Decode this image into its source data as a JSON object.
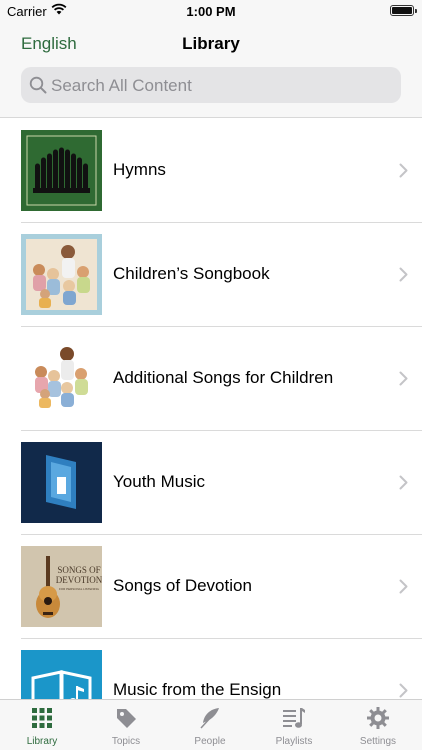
{
  "status_bar": {
    "carrier": "Carrier",
    "time": "1:00 PM"
  },
  "nav": {
    "left_label": "English",
    "title": "Library"
  },
  "search": {
    "placeholder": "Search All Content"
  },
  "library_items": [
    {
      "label": "Hymns"
    },
    {
      "label": "Children’s Songbook"
    },
    {
      "label": "Additional Songs for Children"
    },
    {
      "label": "Youth Music"
    },
    {
      "label": "Songs of Devotion",
      "thumb_text": [
        "SONGS OF",
        "DEVOTION",
        "FOR PERSONAL LISTENING"
      ]
    },
    {
      "label": "Music from the Ensign"
    }
  ],
  "tabs": [
    {
      "label": "Library",
      "icon": "grid-icon",
      "active": true
    },
    {
      "label": "Topics",
      "icon": "tag-icon",
      "active": false
    },
    {
      "label": "People",
      "icon": "feather-icon",
      "active": false
    },
    {
      "label": "Playlists",
      "icon": "playlist-icon",
      "active": false
    },
    {
      "label": "Settings",
      "icon": "gear-icon",
      "active": false
    }
  ],
  "colors": {
    "accent": "#2e6b3e",
    "inactive": "#8e8e93",
    "separator": "#dadada"
  }
}
